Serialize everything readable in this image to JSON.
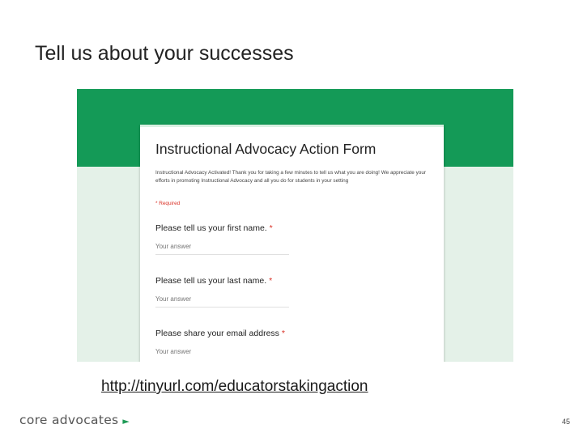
{
  "slide": {
    "title": "Tell us about your successes",
    "url": "http://tinyurl.com/educatorstakingaction",
    "logo_text": "core advocates",
    "logo_arrow": "►",
    "page_number": "45"
  },
  "form": {
    "title": "Instructional Advocacy Action Form",
    "description": "Instructional Advocacy Activated! Thank you for taking a few minutes to tell us what you are doing! We appreciate your efforts in promoting Instructional Advocacy and all you do for students in your setting",
    "required_note": "* Required",
    "questions": [
      {
        "label": "Please tell us your first name.",
        "required_mark": "*",
        "placeholder": "Your answer"
      },
      {
        "label": "Please tell us your last name.",
        "required_mark": "*",
        "placeholder": "Your answer"
      },
      {
        "label": "Please share your email address",
        "required_mark": "*",
        "placeholder": "Your answer"
      }
    ]
  },
  "colors": {
    "header_green": "#149a57",
    "background_tint": "#e4f1e8",
    "required_red": "#d93025",
    "logo_arrow_green": "#1e9a56"
  }
}
